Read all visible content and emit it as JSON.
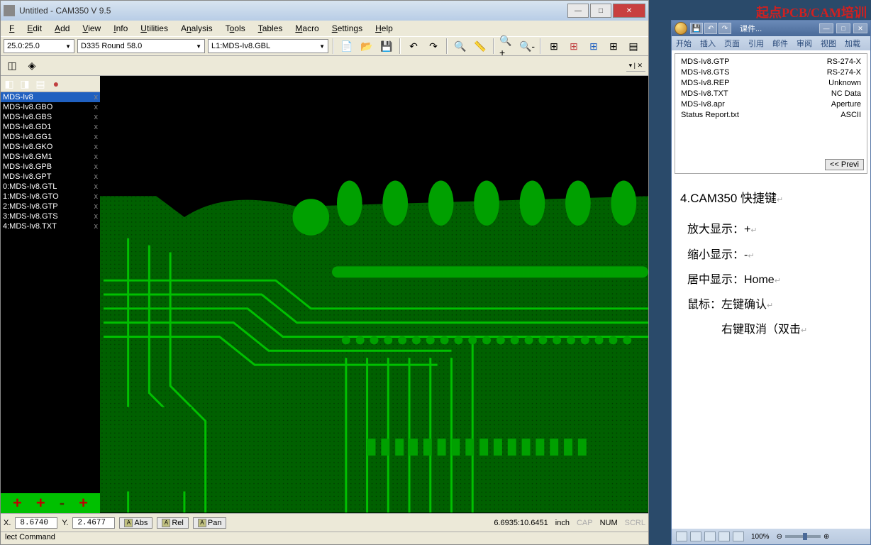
{
  "app": {
    "title": "Untitled - CAM350 V 9.5",
    "window_controls": {
      "min": "—",
      "max": "□",
      "close": "✕"
    }
  },
  "menu": [
    "File",
    "Edit",
    "Add",
    "View",
    "Info",
    "Utilities",
    "Analysis",
    "Tools",
    "Tables",
    "Macro",
    "Settings",
    "Help"
  ],
  "toolbar": {
    "coord_scale": "25.0:25.0",
    "aperture": "D335  Round 58.0",
    "layer": "L1:MDS-Iv8.GBL"
  },
  "layers": [
    {
      "name": "MDS-Iv8",
      "selected": true
    },
    {
      "name": "MDS-Iv8.GBO",
      "selected": false
    },
    {
      "name": "MDS-Iv8.GBS",
      "selected": false
    },
    {
      "name": "MDS-Iv8.GD1",
      "selected": false
    },
    {
      "name": "MDS-Iv8.GG1",
      "selected": false
    },
    {
      "name": "MDS-Iv8.GKO",
      "selected": false
    },
    {
      "name": "MDS-Iv8.GM1",
      "selected": false
    },
    {
      "name": "MDS-Iv8.GPB",
      "selected": false
    },
    {
      "name": "MDS-Iv8.GPT",
      "selected": false
    },
    {
      "name": "0:MDS-Iv8.GTL",
      "selected": false
    },
    {
      "name": "1:MDS-Iv8.GTO",
      "selected": false
    },
    {
      "name": "2:MDS-Iv8.GTP",
      "selected": false
    },
    {
      "name": "3:MDS-Iv8.GTS",
      "selected": false
    },
    {
      "name": "4:MDS-Iv8.TXT",
      "selected": false
    }
  ],
  "status": {
    "x_label": "X.",
    "x": "8.6740",
    "y_label": "Y.",
    "y": "2.4677",
    "abs": "Abs",
    "rel": "Rel",
    "pan": "Pan",
    "ratio": "6.6935:10.6451",
    "unit": "inch",
    "cap": "CAP",
    "num": "NUM",
    "scrl": "SCRL"
  },
  "command_line": "lect Command",
  "logo": "起点PCB/CAM培训",
  "word": {
    "title": "课件...",
    "win_min": "—",
    "win_max": "□",
    "win_close": "✕",
    "tabs": [
      "开始",
      "插入",
      "页面",
      "引用",
      "邮件",
      "审阅",
      "视图",
      "加载"
    ],
    "file_list": [
      {
        "name": "MDS-Iv8.GTP",
        "type": "RS-274-X"
      },
      {
        "name": "MDS-Iv8.GTS",
        "type": "RS-274-X"
      },
      {
        "name": "MDS-Iv8.REP",
        "type": "Unknown"
      },
      {
        "name": "MDS-Iv8.TXT",
        "type": "NC Data"
      },
      {
        "name": "MDS-Iv8.apr",
        "type": "Aperture"
      },
      {
        "name": "Status Report.txt",
        "type": "ASCII"
      }
    ],
    "preview_btn": "<< Previ",
    "doc": {
      "heading": "4.CAM350 快捷键",
      "lines": [
        "放大显示：+",
        "缩小显示：-",
        "居中显示：Home",
        "鼠标：左键确认",
        "　　　右键取消（双击"
      ]
    },
    "zoom": "100%"
  }
}
